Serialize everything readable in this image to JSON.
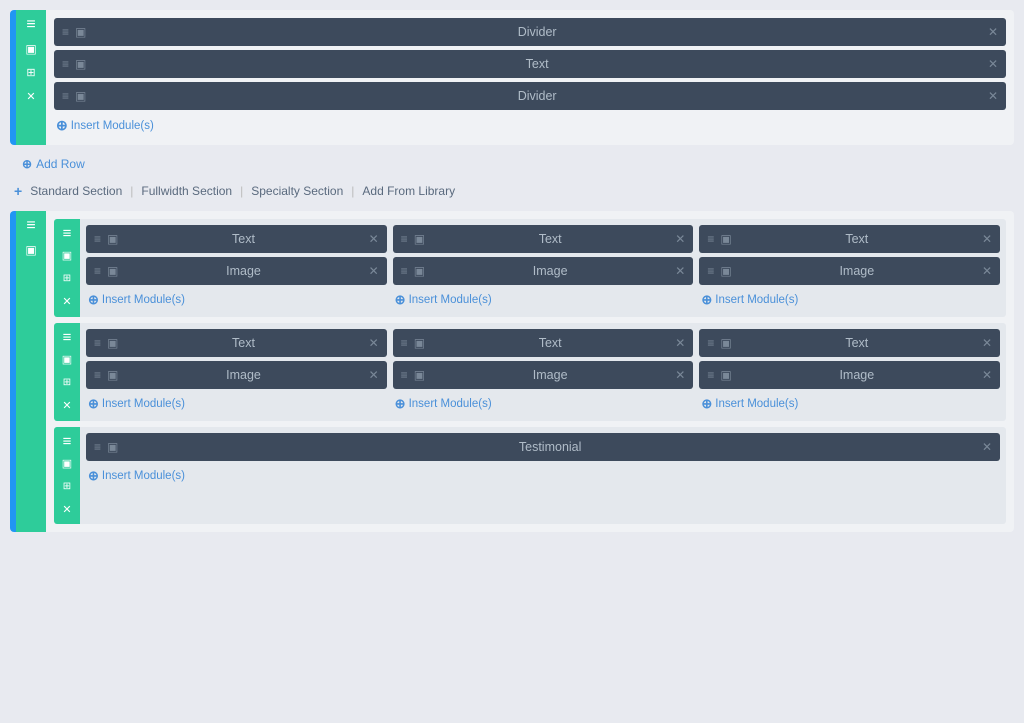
{
  "sections": {
    "top_section": {
      "modules": [
        {
          "label": "Divider",
          "id": "divider1"
        },
        {
          "label": "Text",
          "id": "text1"
        },
        {
          "label": "Divider",
          "id": "divider2"
        }
      ],
      "insert_label": "Insert Module(s)",
      "add_row_label": "Add Row"
    },
    "separator": {
      "items": [
        {
          "label": "Standard Section"
        },
        {
          "label": "Fullwidth Section"
        },
        {
          "label": "Specialty Section"
        },
        {
          "label": "Add From Library"
        }
      ]
    },
    "bottom_section": {
      "rows": [
        {
          "id": "row1",
          "cols": [
            {
              "modules": [
                {
                  "label": "Text"
                },
                {
                  "label": "Image"
                }
              ],
              "insert_label": "Insert Module(s)"
            },
            {
              "modules": [
                {
                  "label": "Text"
                },
                {
                  "label": "Image"
                }
              ],
              "insert_label": "Insert Module(s)"
            },
            {
              "modules": [
                {
                  "label": "Text"
                },
                {
                  "label": "Image"
                }
              ],
              "insert_label": "Insert Module(s)"
            }
          ]
        },
        {
          "id": "row2",
          "cols": [
            {
              "modules": [
                {
                  "label": "Text"
                },
                {
                  "label": "Image"
                }
              ],
              "insert_label": "Insert Module(s)"
            },
            {
              "modules": [
                {
                  "label": "Text"
                },
                {
                  "label": "Image"
                }
              ],
              "insert_label": "Insert Module(s)"
            },
            {
              "modules": [
                {
                  "label": "Text"
                },
                {
                  "label": "Image"
                }
              ],
              "insert_label": "Insert Module(s)"
            }
          ]
        },
        {
          "id": "row3",
          "cols": [
            {
              "modules": [
                {
                  "label": "Testimonial"
                }
              ],
              "insert_label": "Insert Module(s)"
            }
          ]
        }
      ]
    }
  },
  "icons": {
    "hamburger": "≡",
    "monitor": "▣",
    "grid": "⊞",
    "close": "✕",
    "plus": "+"
  }
}
